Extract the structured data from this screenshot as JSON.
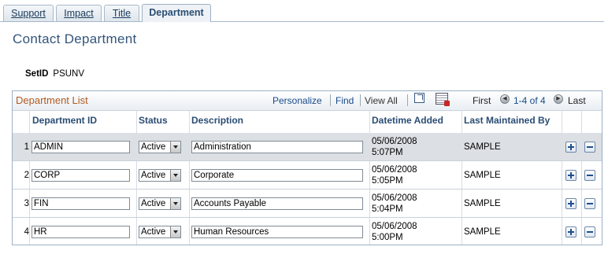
{
  "tabs": [
    {
      "label": "Support",
      "active": false
    },
    {
      "label": "Impact",
      "active": false
    },
    {
      "label": "Title",
      "active": false
    },
    {
      "label": "Department",
      "active": true
    }
  ],
  "page": {
    "title": "Contact Department",
    "setid_label": "SetID",
    "setid_value": "PSUNV"
  },
  "grid": {
    "title": "Department List",
    "personalize": "Personalize",
    "find": "Find",
    "view_all": "View All",
    "first": "First",
    "range": "1-4 of 4",
    "last": "Last",
    "columns": [
      "Department ID",
      "Status",
      "Description",
      "Datetime Added",
      "Last Maintained By"
    ],
    "rows": [
      {
        "num": "1",
        "dept_id": "ADMIN",
        "status": "Active",
        "description": "Administration",
        "date": "05/06/2008",
        "time": "5:07PM",
        "maintained_by": "SAMPLE"
      },
      {
        "num": "2",
        "dept_id": "CORP",
        "status": "Active",
        "description": "Corporate",
        "date": "05/06/2008",
        "time": "5:05PM",
        "maintained_by": "SAMPLE"
      },
      {
        "num": "3",
        "dept_id": "FIN",
        "status": "Active",
        "description": "Accounts Payable",
        "date": "05/06/2008",
        "time": "5:04PM",
        "maintained_by": "SAMPLE"
      },
      {
        "num": "4",
        "dept_id": "HR",
        "status": "Active",
        "description": "Human Resources",
        "date": "05/06/2008",
        "time": "5:00PM",
        "maintained_by": "SAMPLE"
      }
    ]
  },
  "icons": {
    "zoom": "zoom-grid-icon",
    "download": "download-to-excel-icon",
    "prev": "previous-arrow-icon",
    "next": "next-arrow-icon",
    "add": "add-row-icon",
    "delete": "delete-row-icon"
  },
  "colors": {
    "title": "#33557a",
    "grid_title": "#b35a1f",
    "column_header": "#2a4d73",
    "link": "#1a4a8a",
    "selected_row": "#dcdfe3"
  }
}
